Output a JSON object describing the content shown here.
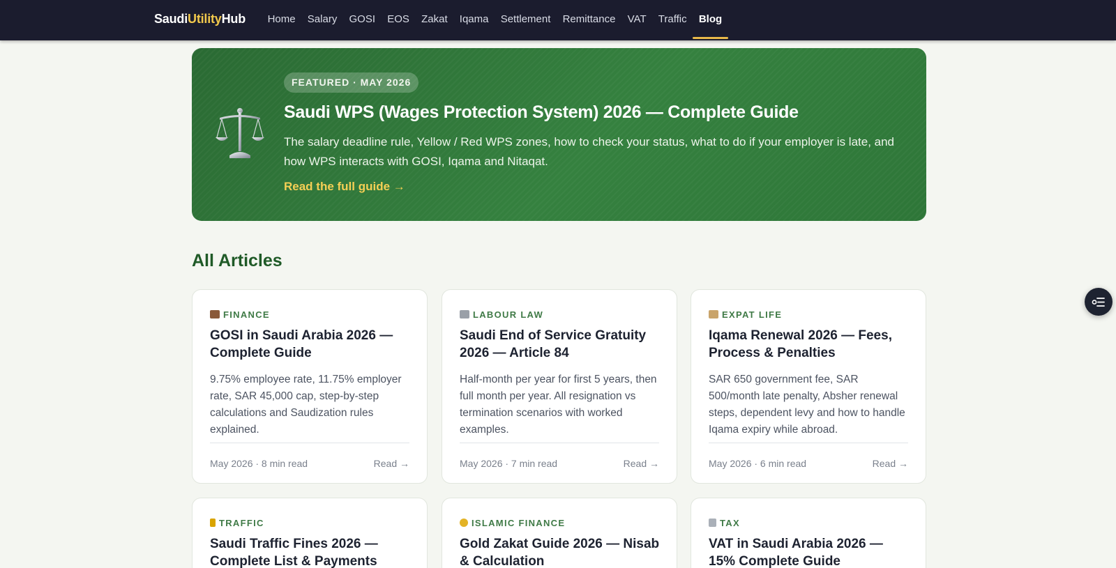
{
  "brand": {
    "part1": "Saudi",
    "part2": "Utility",
    "part3": "Hub"
  },
  "nav": [
    {
      "label": "Home",
      "key": "home"
    },
    {
      "label": "Salary",
      "key": "salary"
    },
    {
      "label": "GOSI",
      "key": "gosi"
    },
    {
      "label": "EOS",
      "key": "eos"
    },
    {
      "label": "Zakat",
      "key": "zakat"
    },
    {
      "label": "Iqama",
      "key": "iqama"
    },
    {
      "label": "Settlement",
      "key": "settlement"
    },
    {
      "label": "Remittance",
      "key": "remittance"
    },
    {
      "label": "VAT",
      "key": "vat"
    },
    {
      "label": "Traffic",
      "key": "traffic"
    },
    {
      "label": "Blog",
      "key": "blog",
      "active": true
    }
  ],
  "featured": {
    "badge": "FEATURED · MAY 2026",
    "icon": "balance-scale-icon",
    "title": "Saudi WPS (Wages Protection System) 2026 — Complete Guide",
    "description": "The salary deadline rule, Yellow / Red WPS zones, how to check your status, what to do if your employer is late, and how WPS interacts with GOSI, Iqama and Nitaqat.",
    "link": "Read the full guide →"
  },
  "section_title": "All Articles",
  "articles": [
    {
      "category": "FINANCE",
      "icon": "briefcase-icon",
      "icon_color": "#8a5a3a",
      "title": "GOSI in Saudi Arabia 2026 — Complete Guide",
      "description": "9.75% employee rate, 11.75% employer rate, SAR 45,000 cap, step-by-step calculations and Saudization rules explained.",
      "meta": "May 2026 · 8 min read",
      "read": "Read →"
    },
    {
      "category": "LABOUR LAW",
      "icon": "balance-scale-icon",
      "icon_color": "#9aa0a8",
      "title": "Saudi End of Service Gratuity 2026 — Article 84",
      "description": "Half-month per year for first 5 years, then full month per year. All resignation vs termination scenarios with worked examples.",
      "meta": "May 2026 · 7 min read",
      "read": "Read →"
    },
    {
      "category": "EXPAT LIFE",
      "icon": "id-card-icon",
      "icon_color": "#c9a46b",
      "title": "Iqama Renewal 2026 — Fees, Process & Penalties",
      "description": "SAR 650 government fee, SAR 500/month late penalty, Absher renewal steps, dependent levy and how to handle Iqama expiry while abroad.",
      "meta": "May 2026 · 6 min read",
      "read": "Read →"
    },
    {
      "category": "TRAFFIC",
      "icon": "traffic-light-icon",
      "icon_color": "#d9a400",
      "title": "Saudi Traffic Fines 2026 — Complete List & Payments"
    },
    {
      "category": "ISLAMIC FINANCE",
      "icon": "crescent-moon-icon",
      "icon_color": "#e3b326",
      "title": "Gold Zakat Guide 2026 — Nisab & Calculation"
    },
    {
      "category": "TAX",
      "icon": "receipt-icon",
      "icon_color": "#aab0b8",
      "title": "VAT in Saudi Arabia 2026 — 15% Complete Guide"
    }
  ],
  "fab_icon": "table-of-contents-icon"
}
